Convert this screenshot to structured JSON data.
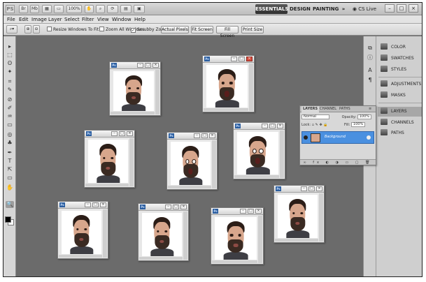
{
  "app": {
    "logo": "PS",
    "launcher_labels": [
      "Br",
      "Mb"
    ],
    "zoom_menu": "100%",
    "workspace_buttons": [
      "ESSENTIALS",
      "DESIGN",
      "PAINTING"
    ],
    "workspace_more": "»",
    "cs_live": "CS Live",
    "window_controls": [
      "–",
      "□",
      "×"
    ]
  },
  "menu": [
    "File",
    "Edit",
    "Image",
    "Layer",
    "Select",
    "Filter",
    "View",
    "Window",
    "Help"
  ],
  "options_bar": {
    "resize_windows": "Resize Windows To Fit",
    "zoom_all_windows": "Zoom All Windows",
    "scrubby_zoom": "Scrubby Zoom",
    "buttons": [
      "Actual Pixels",
      "Fit Screen",
      "Fill Screen",
      "Print Size"
    ]
  },
  "tools": [
    "▸",
    "⬚",
    "ʘ",
    "✦",
    "⌗",
    "✎",
    "⊘",
    "✐",
    "♒",
    "▭",
    "◎",
    "♣",
    "✒",
    "T",
    "⇱",
    "▭",
    "✋",
    "🔍"
  ],
  "dock": {
    "items": [
      "COLOR",
      "SWATCHES",
      "STYLES",
      "ADJUSTMENTS",
      "MASKS",
      "LAYERS",
      "CHANNELS",
      "PATHS"
    ],
    "selected": "LAYERS"
  },
  "image_window": {
    "badge": "Ps",
    "controls": [
      "–",
      "□",
      "×"
    ]
  },
  "layers_panel": {
    "tabs": [
      "LAYERS",
      "CHANNEL",
      "PATHS"
    ],
    "blend_mode": "Normal",
    "opacity_label": "Opacity:",
    "opacity_value": "100%",
    "lock_label": "Lock:",
    "fill_label": "Fill:",
    "fill_value": "100%",
    "layer_name": "Background",
    "footer": "∞ fx ◐ ◑ ▭ ▢ 🗑"
  }
}
